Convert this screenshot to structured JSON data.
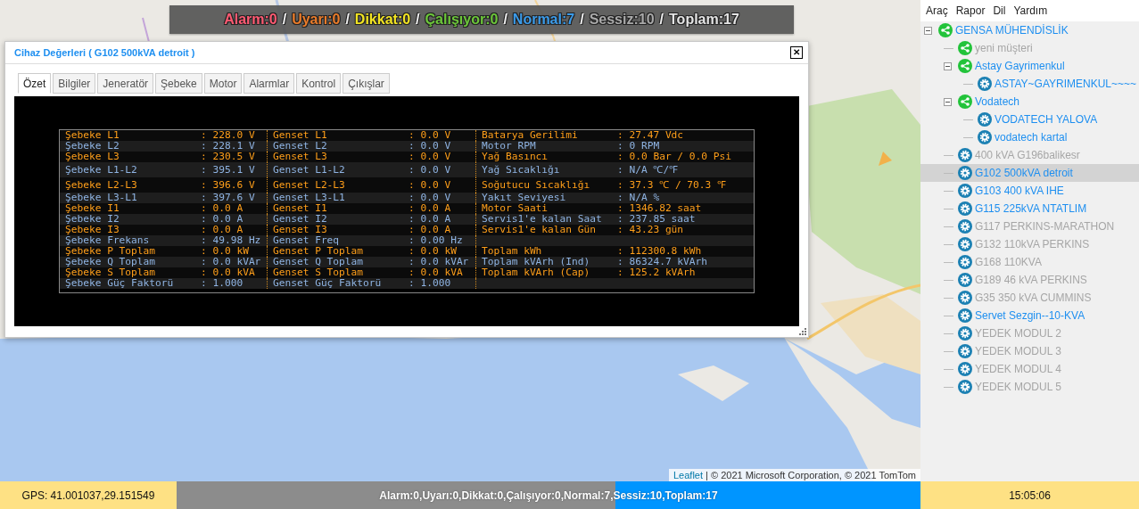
{
  "status_overlay": [
    {
      "text": "Alarm:0",
      "color": "#ff5a72"
    },
    {
      "text": "Uyarı:0",
      "color": "#e97b2a"
    },
    {
      "text": "Dikkat:0",
      "color": "#f2e422"
    },
    {
      "text": "Çalışıyor:0",
      "color": "#6cc63a"
    },
    {
      "text": "Normal:7",
      "color": "#3b9be9"
    },
    {
      "text": "Sessiz:10",
      "color": "#a9a9a9"
    },
    {
      "text": "Toplam:17",
      "color": "#e4e4e4"
    }
  ],
  "overlay_separator": "/",
  "dialog": {
    "title": "Cihaz Değerleri ( G102 500kVA detroit )",
    "close": "✕",
    "tabs": [
      {
        "label": "Özet",
        "selected": true
      },
      {
        "label": "Bilgiler",
        "selected": false
      },
      {
        "label": "Jeneratör",
        "selected": false
      },
      {
        "label": "Şebeke",
        "selected": false
      },
      {
        "label": "Motor",
        "selected": false
      },
      {
        "label": "Alarmlar",
        "selected": false
      },
      {
        "label": "Kontrol",
        "selected": false
      },
      {
        "label": "Çıkışlar",
        "selected": false
      }
    ],
    "rows": [
      {
        "color": "#ff9f1a",
        "cells": [
          [
            "Şebeke L1",
            ": 228.0 V"
          ],
          [
            "Genset L1",
            ": 0.0 V"
          ],
          [
            "Batarya Gerilimi",
            ": 27.47 Vdc"
          ]
        ]
      },
      {
        "color": "#8fb4e3",
        "cells": [
          [
            "Şebeke L2",
            ": 228.1 V"
          ],
          [
            "Genset L2",
            ": 0.0 V"
          ],
          [
            "Motor RPM",
            ": 0 RPM"
          ]
        ]
      },
      {
        "color": "#ff9f1a",
        "cells": [
          [
            "Şebeke L3",
            ": 230.5 V"
          ],
          [
            "Genset L3",
            ": 0.0 V"
          ],
          [
            "Yağ Basıncı",
            ": 0.0 Bar / 0.0 Psi"
          ]
        ]
      },
      {
        "color": "#8fb4e3",
        "cells": [
          [
            "Şebeke L1-L2",
            ": 395.1 V"
          ],
          [
            "Genset L1-L2",
            ": 0.0 V"
          ],
          [
            "Yağ Sıcaklığı",
            ": N/A ℃/℉"
          ]
        ]
      },
      {
        "color": "#ff9f1a",
        "cells": [
          [
            "Şebeke L2-L3",
            ": 396.6 V"
          ],
          [
            "Genset L2-L3",
            ": 0.0 V"
          ],
          [
            "Soğutucu Sıcaklığı",
            ": 37.3 ℃ / 70.3 ℉"
          ]
        ]
      },
      {
        "color": "#8fb4e3",
        "cells": [
          [
            "Şebeke L3-L1",
            ": 397.6 V"
          ],
          [
            "Genset L3-L1",
            ": 0.0 V"
          ],
          [
            "Yakıt Seviyesi",
            ": N/A %"
          ]
        ]
      },
      {
        "color": "#ff9f1a",
        "cells": [
          [
            "Şebeke I1",
            ": 0.0 A"
          ],
          [
            "Genset I1",
            ": 0.0 A"
          ],
          [
            "Motor Saati",
            ": 1346.82 saat"
          ]
        ]
      },
      {
        "color": "#8fb4e3",
        "cells": [
          [
            "Şebeke I2",
            ": 0.0 A"
          ],
          [
            "Genset I2",
            ": 0.0 A"
          ],
          [
            "Servis1'e kalan Saat",
            ": 237.85 saat"
          ]
        ]
      },
      {
        "color": "#ff9f1a",
        "cells": [
          [
            "Şebeke I3",
            ": 0.0 A"
          ],
          [
            "Genset I3",
            ": 0.0 A"
          ],
          [
            "Servis1'e kalan Gün",
            ": 43.23 gün"
          ]
        ]
      },
      {
        "color": "#8fb4e3",
        "cells": [
          [
            "Şebeke Frekans",
            ": 49.98 Hz"
          ],
          [
            "Genset Freq",
            ": 0.00 Hz"
          ]
        ]
      },
      {
        "color": "#ff9f1a",
        "cells": [
          [
            "Şebeke P Toplam",
            ": 0.0 kW"
          ],
          [
            "Genset P Toplam",
            ": 0.0 kW"
          ],
          [
            "Toplam kWh",
            ": 112300.8 kWh"
          ]
        ]
      },
      {
        "color": "#8fb4e3",
        "cells": [
          [
            "Şebeke Q Toplam",
            ": 0.0 kVAr"
          ],
          [
            "Genset Q Toplam",
            ": 0.0 kVAr"
          ],
          [
            "Toplam kVArh (Ind)",
            ": 86324.7 kVArh"
          ]
        ]
      },
      {
        "color": "#ff9f1a",
        "cells": [
          [
            "Şebeke S Toplam",
            ": 0.0 kVA"
          ],
          [
            "Genset S Toplam",
            ": 0.0 kVA"
          ],
          [
            "Toplam kVArh (Cap)",
            ": 125.2 kVArh"
          ]
        ]
      },
      {
        "color": "#8fb4e3",
        "cells": [
          [
            "Şebeke Güç Faktorü",
            ": 1.000"
          ],
          [
            "Genset Güç Faktorü",
            ": 1.000"
          ]
        ]
      }
    ]
  },
  "attribution": {
    "link": "Leaflet",
    "text": "| © 2021 Microsoft Corporation, © 2021 TomTom"
  },
  "menu": [
    "Araç",
    "Rapor",
    "Dil",
    "Yardım"
  ],
  "tree": [
    {
      "label": "GENSA MÜHENDİSLİK",
      "kind": "group",
      "active": true,
      "selected": false,
      "expanded": true,
      "children": [
        {
          "label": "yeni müşteri",
          "kind": "group",
          "active": false,
          "selected": false
        },
        {
          "label": "Astay Gayrimenkul",
          "kind": "group",
          "active": true,
          "selected": false,
          "expanded": true,
          "children": [
            {
              "label": "ASTAY~GAYRIMENKUL~~~~",
              "kind": "device",
              "active": true,
              "selected": false
            }
          ]
        },
        {
          "label": "Vodatech",
          "kind": "group",
          "active": true,
          "selected": false,
          "expanded": true,
          "children": [
            {
              "label": "VODATECH YALOVA",
              "kind": "device",
              "active": true,
              "selected": false
            },
            {
              "label": "vodatech kartal",
              "kind": "device",
              "active": true,
              "selected": false
            }
          ]
        },
        {
          "label": "400 kVA G196balikesr",
          "kind": "device",
          "active": false,
          "selected": false
        },
        {
          "label": "G102 500kVA detroit",
          "kind": "device",
          "active": true,
          "selected": true
        },
        {
          "label": "G103 400 kVA IHE",
          "kind": "device",
          "active": true,
          "selected": false
        },
        {
          "label": "G115 225kVA NTATLIM",
          "kind": "device",
          "active": true,
          "selected": false
        },
        {
          "label": "G117 PERKINS-MARATHON",
          "kind": "device",
          "active": false,
          "selected": false
        },
        {
          "label": "G132 110kVA PERKINS",
          "kind": "device",
          "active": false,
          "selected": false
        },
        {
          "label": "G168 110KVA",
          "kind": "device",
          "active": false,
          "selected": false
        },
        {
          "label": "G189 46 kVA PERKINS",
          "kind": "device",
          "active": false,
          "selected": false
        },
        {
          "label": "G35 350 kVA CUMMINS",
          "kind": "device",
          "active": false,
          "selected": false
        },
        {
          "label": "Servet Sezgin--10-KVA",
          "kind": "device",
          "active": true,
          "selected": false
        },
        {
          "label": "YEDEK MODUL 2",
          "kind": "device",
          "active": false,
          "selected": false
        },
        {
          "label": "YEDEK MODUL 3",
          "kind": "device",
          "active": false,
          "selected": false
        },
        {
          "label": "YEDEK MODUL 4",
          "kind": "device",
          "active": false,
          "selected": false
        },
        {
          "label": "YEDEK MODUL 5",
          "kind": "device",
          "active": false,
          "selected": false
        }
      ]
    }
  ],
  "status_bar": {
    "gps": "GPS: 41.001037,29.151549",
    "summary": "Alarm:0,Uyarı:0,Dikkat:0,Çalışıyor:0,Normal:7,Sessiz:10,Toplam:17",
    "level": 0.41,
    "time": "15:05:06"
  }
}
